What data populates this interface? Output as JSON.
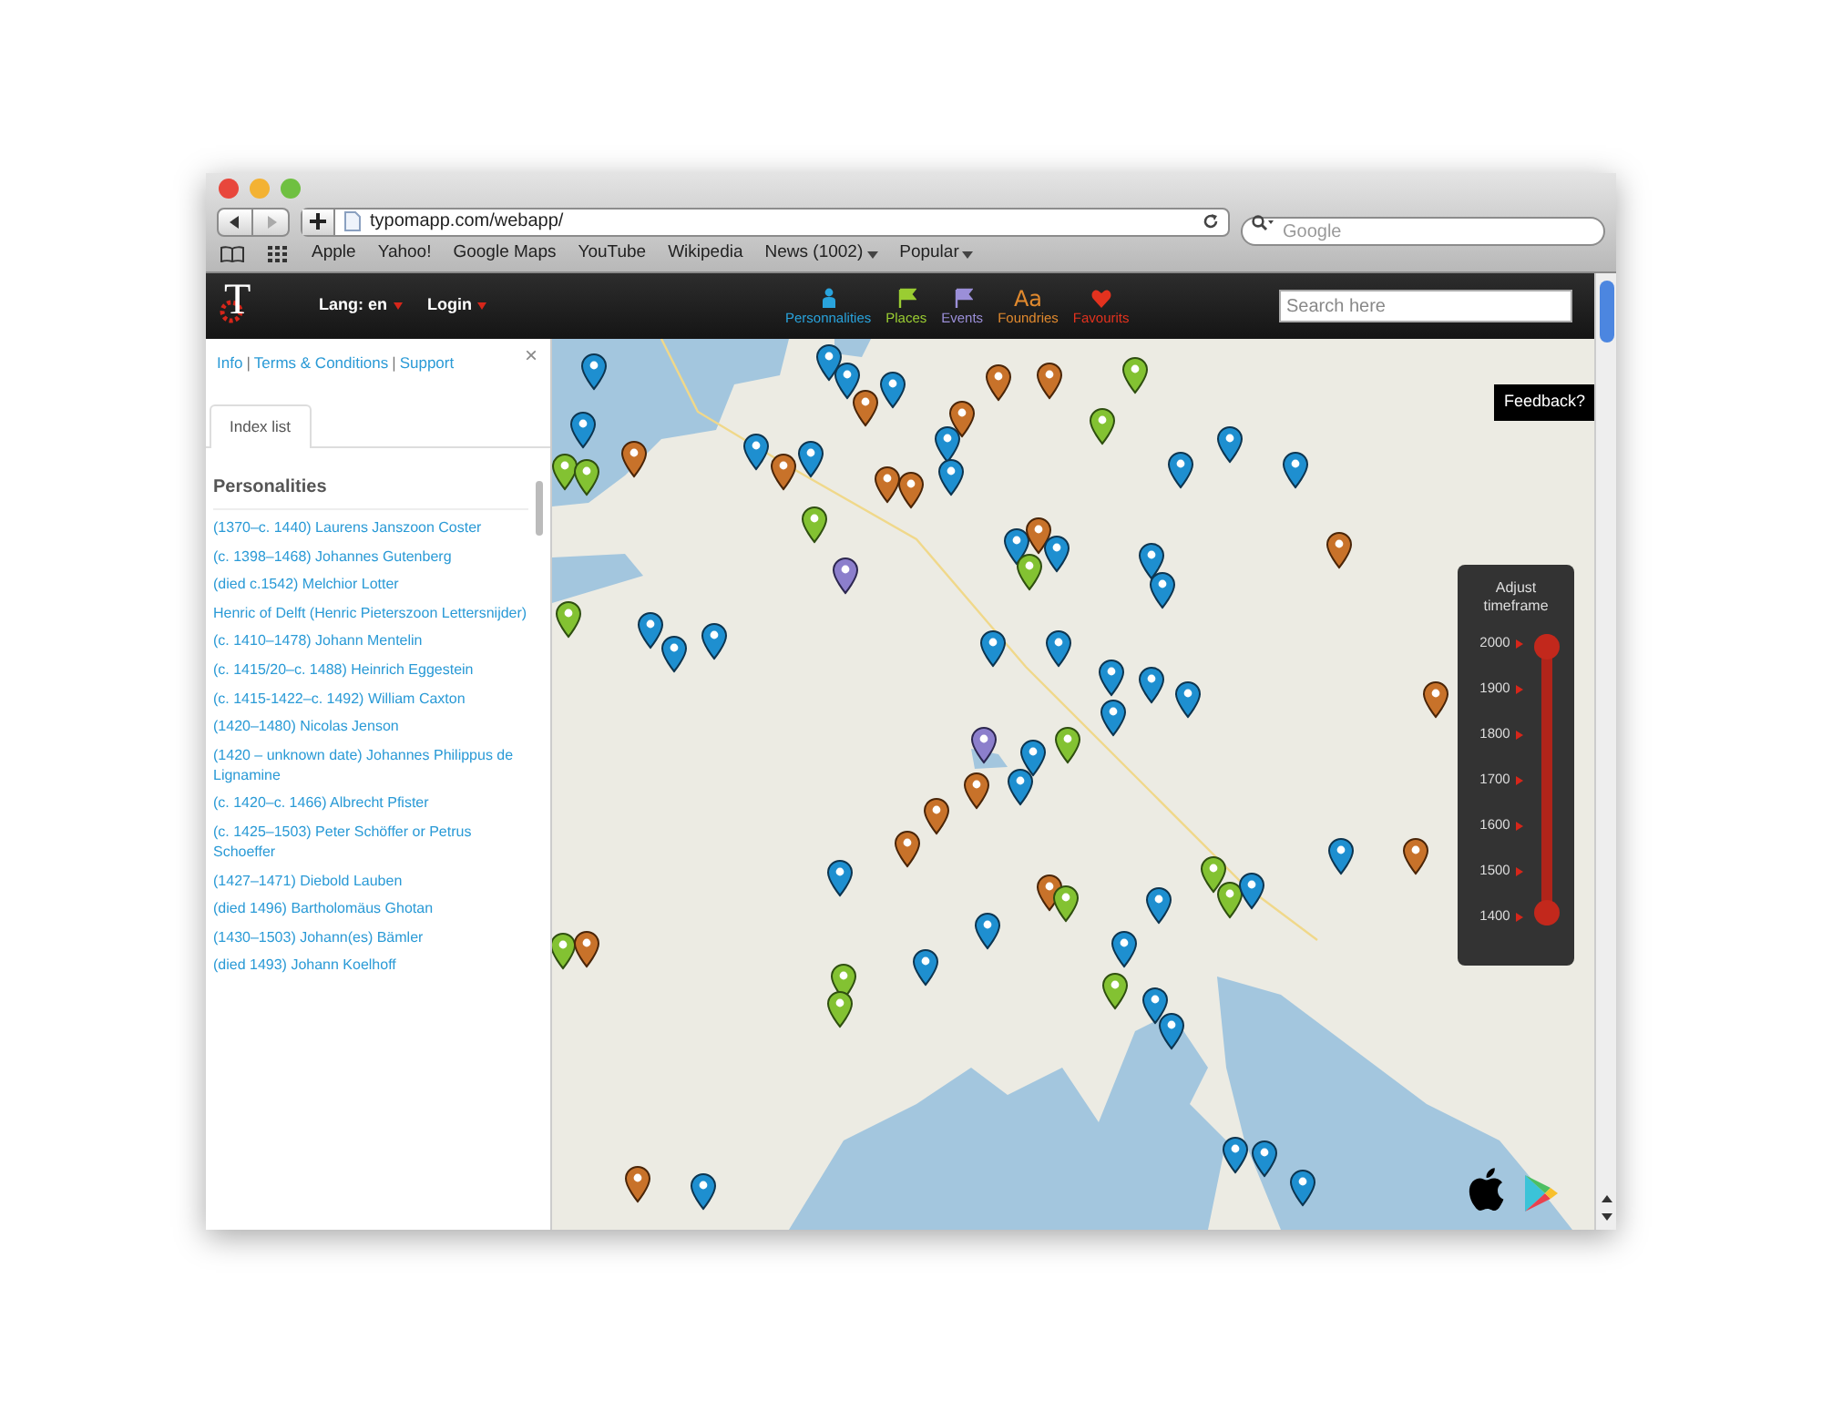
{
  "browser": {
    "address": "typomapp.com/webapp/",
    "search_placeholder": "Google",
    "bookmarks": [
      {
        "label": "Apple",
        "menu": false
      },
      {
        "label": "Yahoo!",
        "menu": false
      },
      {
        "label": "Google Maps",
        "menu": false
      },
      {
        "label": "YouTube",
        "menu": false
      },
      {
        "label": "Wikipedia",
        "menu": false
      },
      {
        "label": "News (1002)",
        "menu": true
      },
      {
        "label": "Popular",
        "menu": true
      }
    ]
  },
  "header": {
    "logo": "T",
    "menus": [
      "Lang: en",
      "Login"
    ],
    "categories": [
      {
        "label": "Personnalities",
        "color": "#29a3dc"
      },
      {
        "label": "Places",
        "color": "#9acd32"
      },
      {
        "label": "Events",
        "color": "#9b8fd8"
      },
      {
        "label": "Foundries",
        "glyph": "Aa",
        "color": "#e0892e"
      },
      {
        "label": "Favourits",
        "color": "#e3321e"
      }
    ],
    "search_placeholder": "Search here"
  },
  "sidebar": {
    "links": [
      "Info",
      "Terms & Conditions",
      "Support"
    ],
    "separator": "|",
    "close": "×",
    "tabs": [
      {
        "label": "Index list",
        "selected": true
      }
    ],
    "heading": "Personalities",
    "items": [
      "(1370–c. 1440) Laurens Janszoon Coster",
      "(c. 1398–1468) Johannes Gutenberg",
      "(died c.1542) Melchior Lotter",
      "Henric of Delft (Henric Pieterszoon Lettersnijder)",
      "(c. 1410–1478) Johann Mentelin",
      "(c. 1415/20–c. 1488) Heinrich Eggestein",
      "(c. 1415-1422–c. 1492) William Caxton",
      "(1420–1480) Nicolas Jenson",
      "(1420 – unknown date) Johannes Philippus de Lignamine",
      "(c. 1420–c. 1466) Albrecht Pfister",
      "(c. 1425–1503) Peter Schöffer or Petrus Schoeffer",
      "(1427–1471) Diebold Lauben",
      "(died 1496) Bartholomäus Ghotan",
      "(1430–1503) Johann(es) Bämler",
      "(died 1493) Johann Koelhoff"
    ]
  },
  "feedback": "Feedback?",
  "timeframe": {
    "title": "Adjust timeframe",
    "ticks": [
      "2000",
      "1900",
      "1800",
      "1700",
      "1600",
      "1500",
      "1400"
    ],
    "handles": [
      {
        "level": 1
      },
      {
        "level": 0
      }
    ]
  }
}
